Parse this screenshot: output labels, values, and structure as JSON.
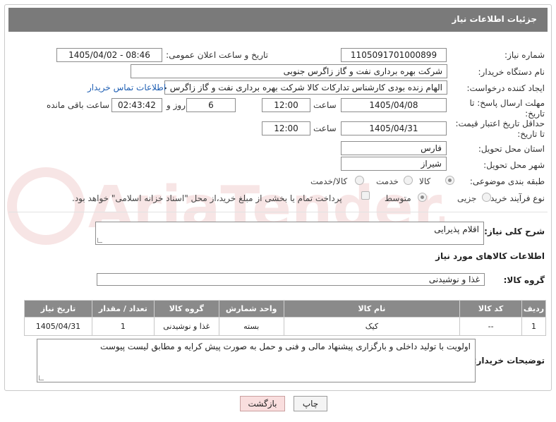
{
  "header": {
    "title": "جزئیات اطلاعات نیاز"
  },
  "fields": {
    "need_number_label": "شماره نیاز:",
    "need_number": "1105091701000899",
    "announce_label": "تاریخ و ساعت اعلان عمومی:",
    "announce_value": "1405/04/02 - 08:46",
    "buyer_label": "نام دستگاه خریدار:",
    "buyer_value": "شرکت بهره برداری نفت و گاز زاگرس جنوبی",
    "creator_label": "ایجاد کننده درخواست:",
    "creator_value": "الهام زنده بودی کارشناس تدارکات کالا شرکت بهره برداری نفت و گاز زاگرس جنوبی",
    "buyer_contact_link": "اطلاعات تماس خریدار",
    "deadline_label": "مهلت ارسال پاسخ: تا تاریخ:",
    "deadline_date": "1405/04/08",
    "time_label": "ساعت",
    "deadline_time": "12:00",
    "days_value": "6",
    "days_label": "روز و",
    "remaining_value": "02:43:42",
    "remaining_label": "ساعت باقی مانده",
    "validity_label": "حداقل تاریخ اعتبار قیمت: تا تاریخ:",
    "validity_date": "1405/04/31",
    "validity_time": "12:00",
    "province_label": "استان محل تحویل:",
    "province_value": "فارس",
    "city_label": "شهر محل تحویل:",
    "city_value": "شیراز",
    "category_label": "طبقه بندی موضوعی:",
    "category_options": [
      "کالا",
      "خدمت",
      "کالا/خدمت"
    ],
    "process_label": "نوع فرآیند خرید :",
    "process_options": [
      "جزیی",
      "متوسط"
    ],
    "payment_note": "پرداخت تمام یا بخشی از مبلغ خرید،از محل \"اسناد خزانه اسلامی\" خواهد بود."
  },
  "summary": {
    "label": "شرح کلی نیاز:",
    "value": "اقلام پذیرایی"
  },
  "goods_info_title": "اطلاعات کالاهای مورد نیاز",
  "goods_group": {
    "label": "گروه کالا:",
    "value": "غذا و نوشیدنی"
  },
  "table": {
    "headers": [
      "ردیف",
      "کد کالا",
      "نام کالا",
      "واحد شمارش",
      "گروه کالا",
      "تعداد / مقدار",
      "تاریخ نیاز"
    ],
    "rows": [
      [
        "1",
        "--",
        "کیک",
        "بسته",
        "غذا و نوشیدنی",
        "1",
        "1405/04/31"
      ]
    ]
  },
  "buyer_notes": {
    "label": "توضیحات خریدار:",
    "value": "اولویت با تولید داخلی و بارگزاری پیشنهاد مالی و فنی و حمل به صورت پیش کرایه و مطابق لیست پیوست"
  },
  "buttons": {
    "print": "چاپ",
    "back": "بازگشت"
  },
  "watermark_text": "AriaTender.neT",
  "colors": {
    "header_bg": "#7a7a7a",
    "link": "#1f5fb3",
    "back_button": "#f9dede"
  }
}
